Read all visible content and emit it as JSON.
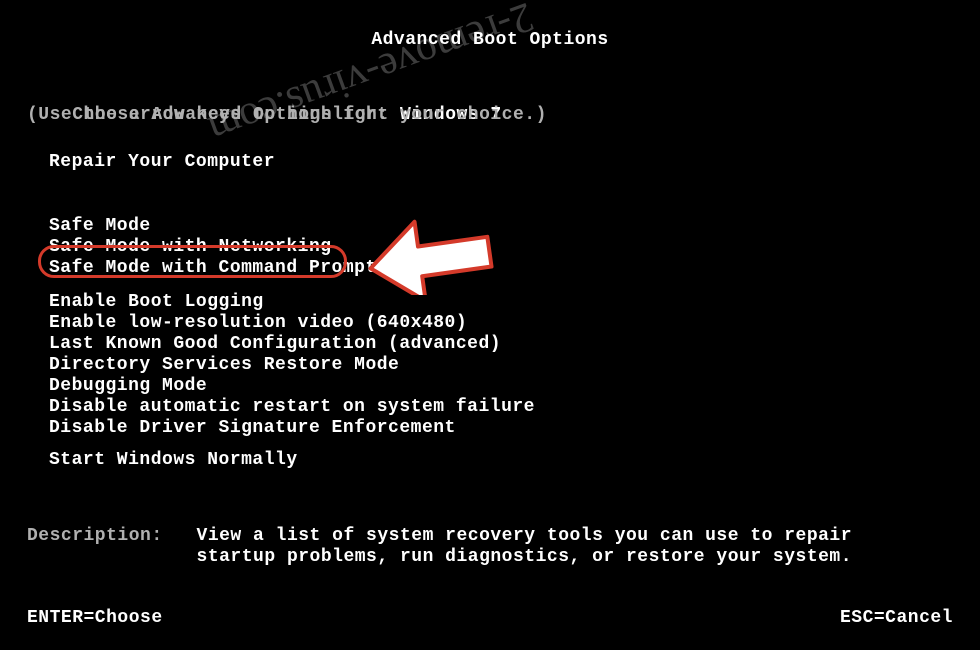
{
  "title": "Advanced Boot Options",
  "choose_prefix": "Choose Advanced Options for: ",
  "os_name": "Windows 7",
  "hint": "(Use the arrow keys to highlight your choice.)",
  "menu": {
    "repair": "Repair Your Computer",
    "group1": [
      "Safe Mode",
      "Safe Mode with Networking",
      "Safe Mode with Command Prompt"
    ],
    "group2": [
      "Enable Boot Logging",
      "Enable low-resolution video (640x480)",
      "Last Known Good Configuration (advanced)",
      "Directory Services Restore Mode",
      "Debugging Mode",
      "Disable automatic restart on system failure",
      "Disable Driver Signature Enforcement"
    ],
    "start": "Start Windows Normally"
  },
  "description": {
    "label": "Description:",
    "text_line1": "View a list of system recovery tools you can use to repair",
    "text_line2": "startup problems, run diagnostics, or restore your system."
  },
  "footer": {
    "enter": "ENTER=Choose",
    "esc": "ESC=Cancel"
  },
  "watermark": "2-remove-virus.com"
}
